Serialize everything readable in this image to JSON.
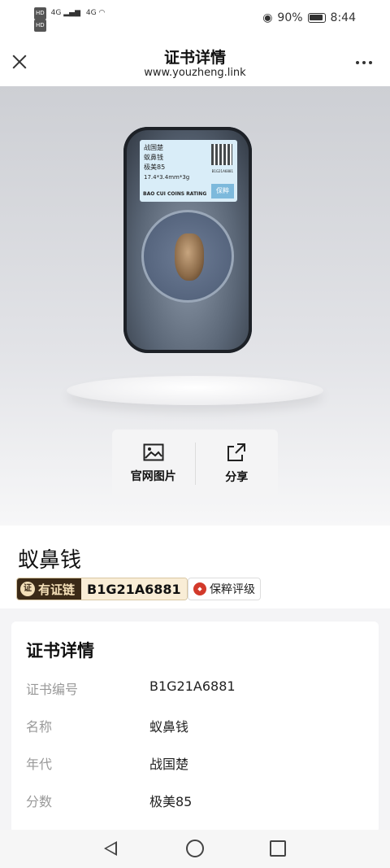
{
  "status_bar": {
    "left_line1": "4G",
    "left_line2": "4G",
    "hd_label": "HD",
    "battery_percent": "90%",
    "time": "8:44"
  },
  "header": {
    "title": "证书详情",
    "subtitle": "www.youzheng.link"
  },
  "slab_label": {
    "era": "战国楚",
    "name": "蚁鼻钱",
    "grade": "极美85",
    "spec": "17.4*3.4mm*3g",
    "brand_en": "BAO CUI COINS RATING",
    "code": "B1G21A6881",
    "badge": "保粹"
  },
  "actions": {
    "official_photo": "官网图片",
    "share": "分享"
  },
  "product": {
    "name": "蚁鼻钱",
    "chain_seal": "证",
    "chain_label": "有证链",
    "chain_code": "B1G21A6881",
    "grade_org": "保粹评级"
  },
  "details": {
    "title": "证书详情",
    "rows": [
      {
        "key": "证书编号",
        "value": "B1G21A6881"
      },
      {
        "key": "名称",
        "value": "蚁鼻钱"
      },
      {
        "key": "年代",
        "value": "战国楚"
      },
      {
        "key": "分数",
        "value": "极美85"
      }
    ]
  }
}
